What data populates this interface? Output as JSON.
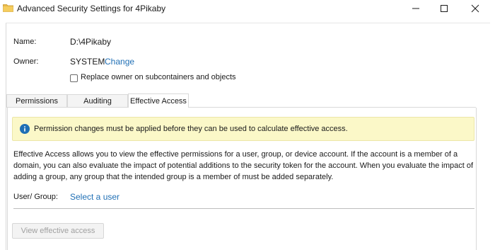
{
  "window": {
    "title": "Advanced Security Settings for 4Pikaby",
    "folder_icon_color": "#e8b84a"
  },
  "info": {
    "name_label": "Name:",
    "name_value": "D:\\4Pikaby",
    "owner_label": "Owner:",
    "owner_value": "SYSTEM",
    "change_link": "Change",
    "replace_owner_checkbox": {
      "label": "Replace owner on subcontainers and objects",
      "checked": false
    }
  },
  "tabs": [
    {
      "label": "Permissions",
      "active": false
    },
    {
      "label": "Auditing",
      "active": false
    },
    {
      "label": "Effective Access",
      "active": true
    }
  ],
  "effective_access": {
    "banner_text": "Permission changes must be applied before they can be used to calculate effective access.",
    "banner_color": "#fbf8c8",
    "info_icon_color": "#1f6fb5",
    "description_lines": [
      "Effective Access allows you to view the effective permissions for a user, group, or device account. If the account is a member of a",
      "domain, you can also evaluate the impact of potential additions to the security token for the account. When you evaluate the impact of",
      "adding a group, any group that the intended group is a member of must be added separately."
    ],
    "user_group_label": "User/ Group:",
    "select_user_link": "Select a user",
    "view_button": "View effective access",
    "view_button_enabled": false
  },
  "colors": {
    "link": "#1f6fb5"
  }
}
